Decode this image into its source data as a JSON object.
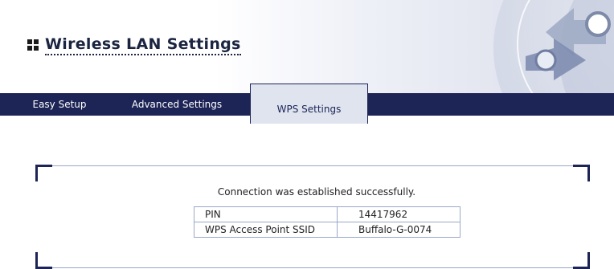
{
  "header": {
    "title": "Wireless LAN Settings",
    "icons": [
      "grid-icon",
      "globe-arrows-icon"
    ]
  },
  "tabs": [
    {
      "label": "Easy Setup",
      "active": false
    },
    {
      "label": "Advanced Settings",
      "active": false
    },
    {
      "label": "WPS Settings",
      "active": true
    }
  ],
  "content": {
    "message": "Connection was established successfully.",
    "rows": [
      {
        "label": "PIN",
        "value": "14417962"
      },
      {
        "label": "WPS Access Point SSID",
        "value": "Buffalo-G-0074"
      }
    ]
  },
  "colors": {
    "nav": "#1d2456",
    "active_tab": "#dfe4ef",
    "border": "#9aa8c6"
  }
}
